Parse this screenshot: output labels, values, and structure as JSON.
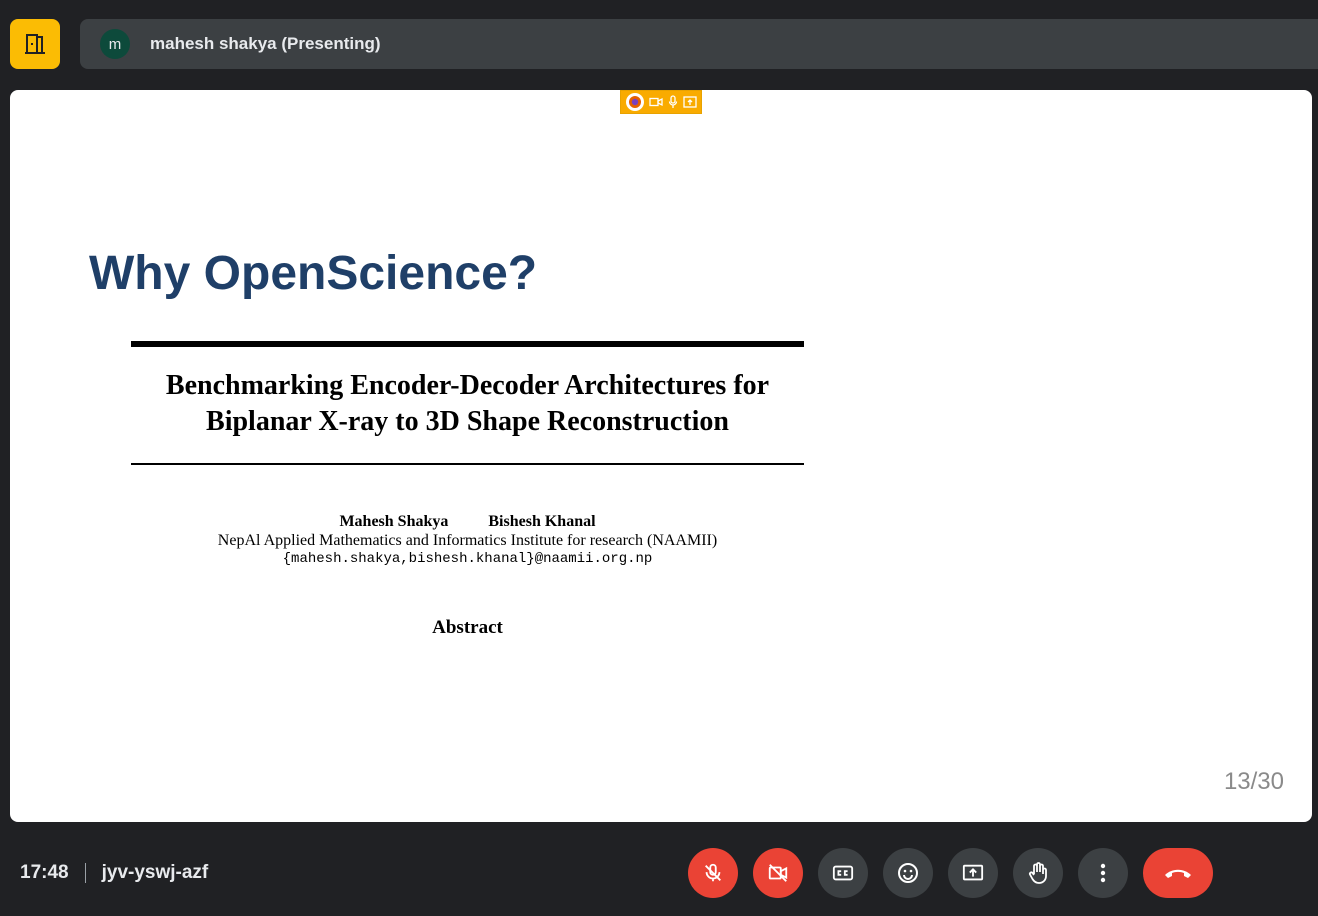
{
  "header": {
    "presenter_initial": "m",
    "presenter_label": "mahesh shakya (Presenting)"
  },
  "slide": {
    "title": "Why OpenScience?",
    "paper_title_line1": "Benchmarking Encoder-Decoder Architectures for",
    "paper_title_line2": "Biplanar X-ray to 3D Shape Reconstruction",
    "author1": "Mahesh Shakya",
    "author2": "Bishesh Khanal",
    "affiliation": "NepAl Applied Mathematics and Informatics Institute for research (NAAMII)",
    "emails": "{mahesh.shakya,bishesh.khanal}@naamii.org.np",
    "abstract_heading": "Abstract",
    "page_number": "13/30"
  },
  "footer": {
    "time": "17:48",
    "meeting_code": "jyv-yswj-azf"
  },
  "icons": {
    "leave": "door-icon",
    "mic": "mic-off-icon",
    "camera": "camera-off-icon",
    "captions": "closed-captions-icon",
    "reactions": "emoji-icon",
    "present": "present-screen-icon",
    "raise_hand": "raise-hand-icon",
    "more": "more-vert-icon",
    "end_call": "end-call-icon"
  },
  "colors": {
    "accent_yellow": "#fbbc04",
    "danger_red": "#ea4335",
    "slide_title": "#1f3f68"
  }
}
